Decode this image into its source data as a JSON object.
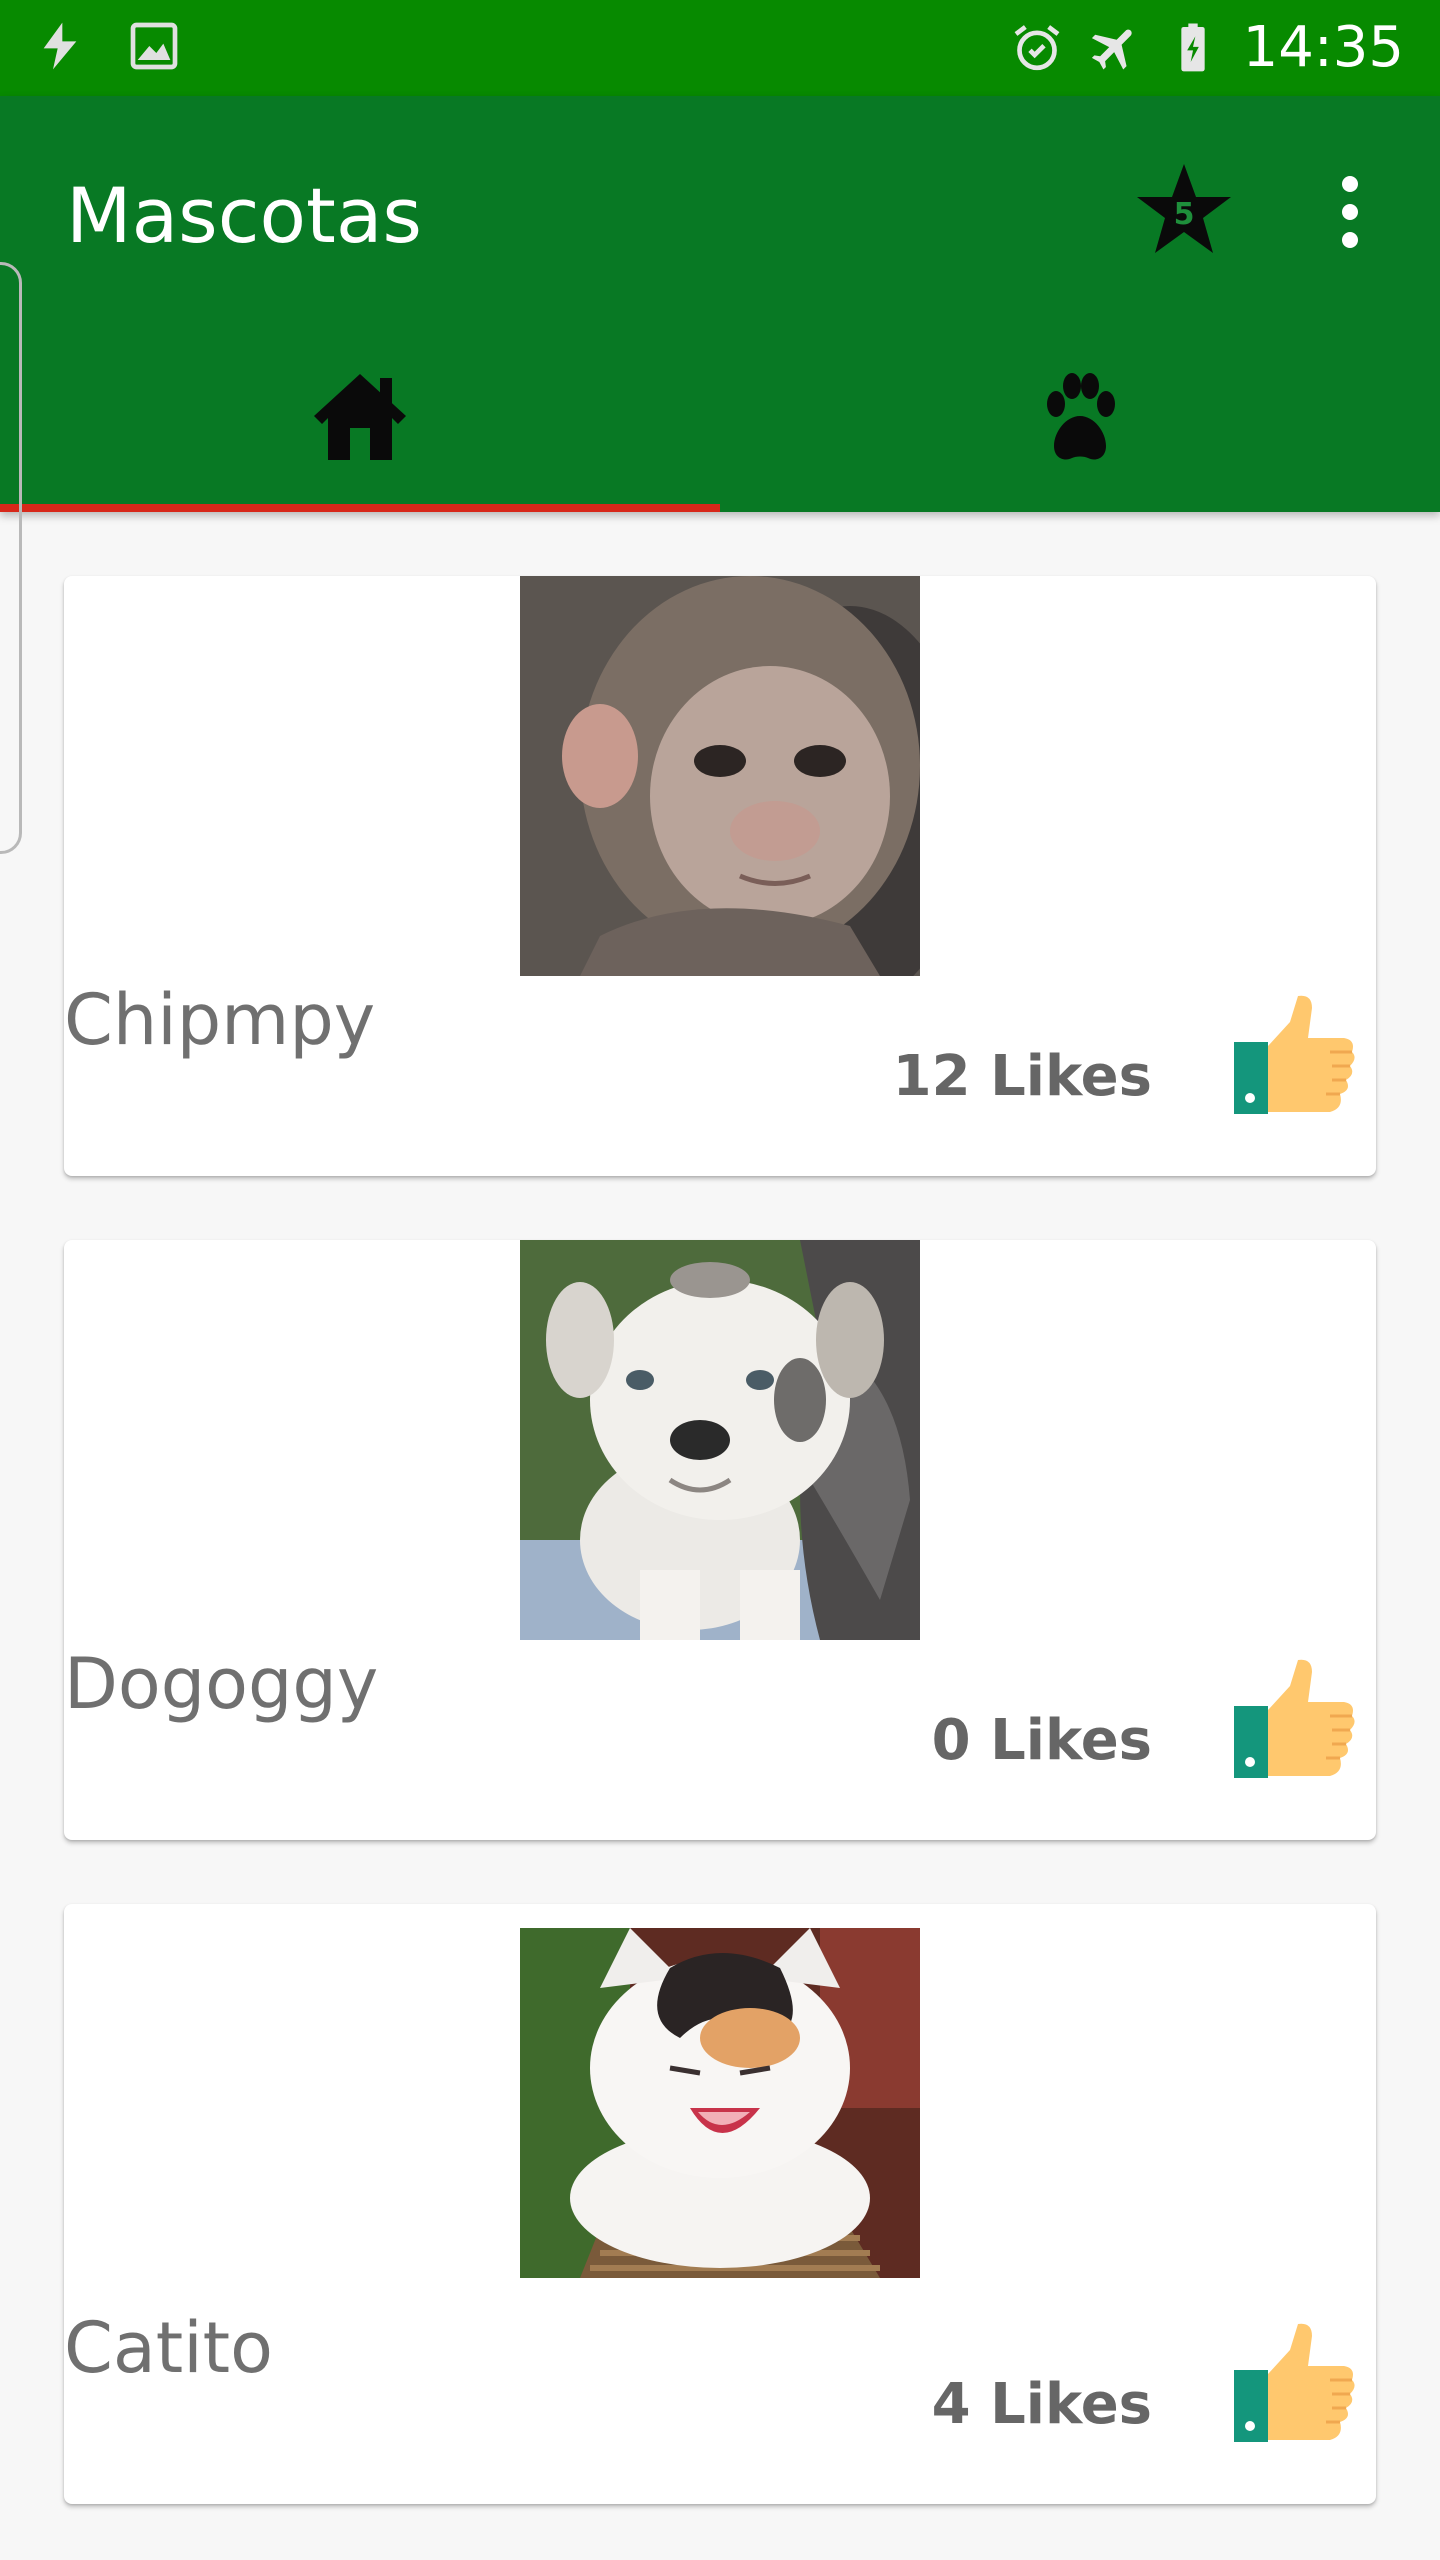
{
  "status_bar": {
    "time": "14:35",
    "icons_left": [
      "flash-icon",
      "image-icon"
    ],
    "icons_right": [
      "alarm-icon",
      "airplane-icon",
      "battery-icon"
    ]
  },
  "app_bar": {
    "title": "Mascotas",
    "favorites_badge": "5",
    "actions": [
      "star-icon",
      "more-vert-icon"
    ]
  },
  "tabs": [
    {
      "icon": "home-icon",
      "selected": true
    },
    {
      "icon": "paw-icon",
      "selected": false
    }
  ],
  "colors": {
    "status_bar": "#078a00",
    "app_bar": "#087924",
    "tab_indicator": "#d7281a",
    "pet_name": "#707070",
    "likes_text": "#666666"
  },
  "pets": [
    {
      "name": "Chipmpy",
      "likes": "12 Likes",
      "photo": "monkey"
    },
    {
      "name": "Dogoggy",
      "likes": "0 Likes",
      "photo": "bulldog-puppy"
    },
    {
      "name": "Catito",
      "likes": "4 Likes",
      "photo": "kitten"
    }
  ]
}
